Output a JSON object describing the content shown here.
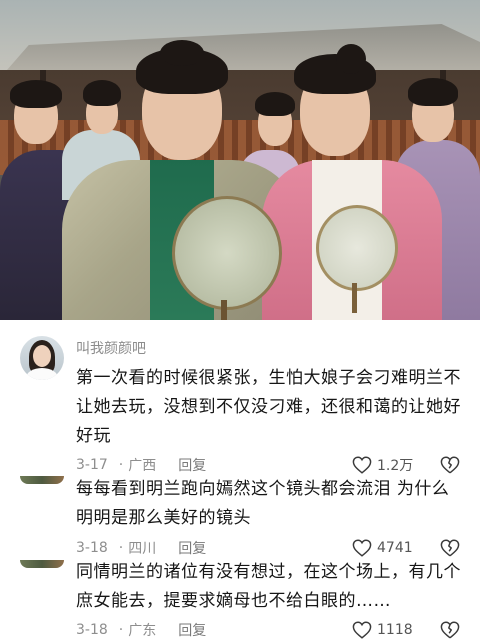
{
  "comments": [
    {
      "username": "叫我颜颜吧",
      "text": "第一次看的时候很紧张，生怕大娘子会刁难明兰不让她去玩，没想到不仅没刁难，还很和蔼的让她好好玩",
      "date": "3-17",
      "location": "广西",
      "reply_label": "回复",
      "likes": "1.2万"
    },
    {
      "username": "",
      "text": "每每看到明兰跑向嫣然这个镜头都会流泪 为什么明明是那么美好的镜头",
      "date": "3-18",
      "location": "四川",
      "reply_label": "回复",
      "likes": "4741"
    },
    {
      "username": "",
      "text": "同情明兰的诸位有没有想过，在这个场上，有几个庶女能去，提要求嫡母也不给白眼的……",
      "date": "3-18",
      "location": "广东",
      "reply_label": "回复",
      "likes": "1118"
    }
  ],
  "icons": {
    "like": "heart-outline-icon",
    "dislike": "broken-heart-icon"
  },
  "colors": {
    "text": "#161616",
    "meta": "#8e8e8e",
    "username": "#8c8c8c"
  }
}
